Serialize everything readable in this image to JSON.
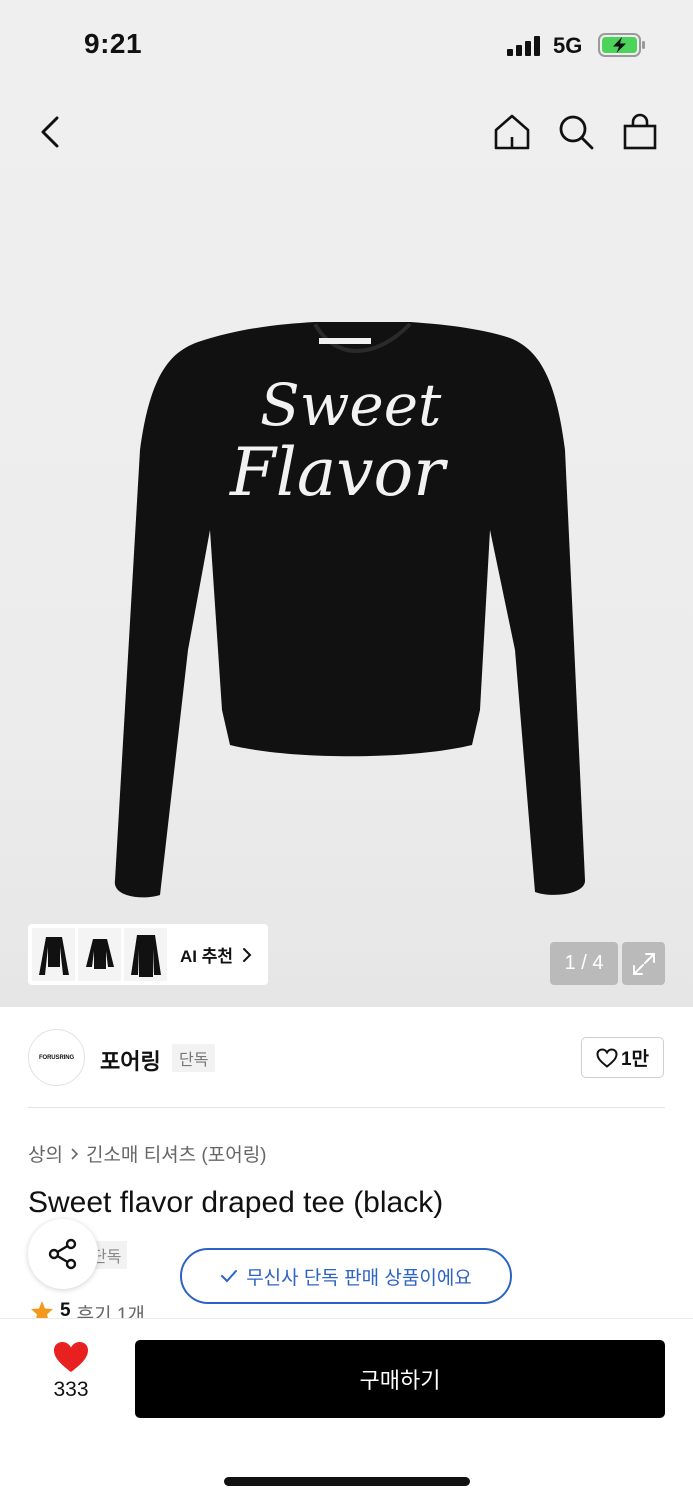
{
  "status_bar": {
    "time": "9:21",
    "network": "5G"
  },
  "gallery": {
    "counter": "1 / 4",
    "ai_label": "AI 추천",
    "garment_text_line1": "Sweet",
    "garment_text_line2": "Flavor"
  },
  "brand": {
    "logo_text": "FORUSRING",
    "name": "포어링",
    "badge": "단독",
    "likes": "1만"
  },
  "product": {
    "breadcrumb": [
      "상의",
      "긴소매 티셔츠 (포어링)"
    ],
    "title": "Sweet flavor draped tee (black)",
    "exclusive_tag": "단독",
    "toast": "무신사 단독 판매 상품이에요",
    "rating": "5",
    "reviews": "후기 1개"
  },
  "bottom_bar": {
    "like_count": "333",
    "buy_label": "구매하기"
  },
  "colors": {
    "accent_blue": "#2c63c6",
    "heart_red": "#e8201f",
    "star_orange": "#f39a1e",
    "buy_black": "#000000"
  }
}
